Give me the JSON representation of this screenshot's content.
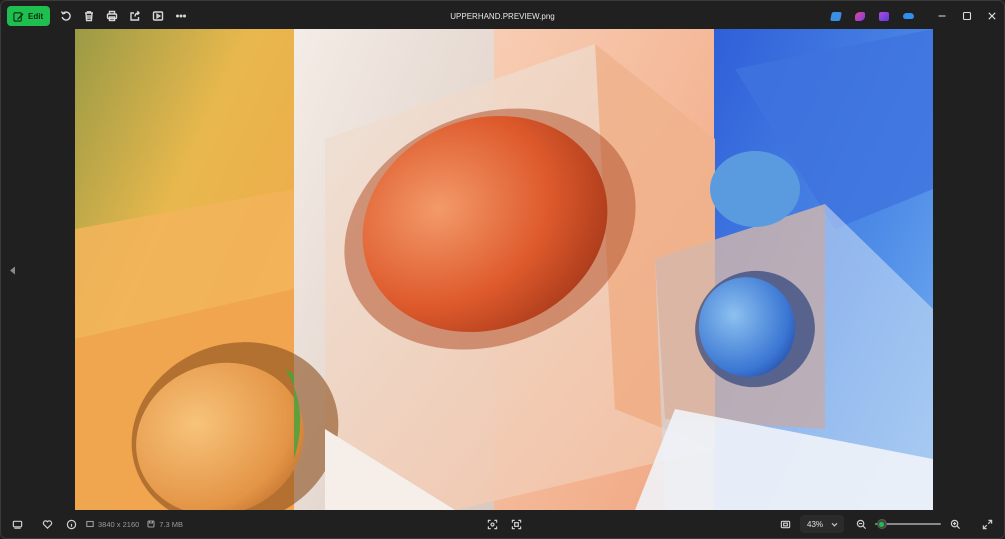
{
  "window": {
    "title": "UPPERHAND.PREVIEW.png"
  },
  "toolbar": {
    "edit_label": "Edit",
    "tools": [
      "rotate-icon",
      "delete-icon",
      "print-icon",
      "share-icon",
      "slideshow-icon",
      "more-icon"
    ]
  },
  "apps": [
    {
      "name": "app-icon-1",
      "color": "#3a8fe0"
    },
    {
      "name": "app-icon-2",
      "color": "#c53fd6"
    },
    {
      "name": "app-icon-3",
      "color": "#8e44e8"
    },
    {
      "name": "onedrive-icon",
      "color": "#2f8ef0"
    }
  ],
  "status": {
    "dimensions": "3840 x 2160",
    "file_size": "7.3 MB",
    "zoom_label": "43%",
    "zoom_fraction": 0.1
  },
  "colors": {
    "accent": "#1fbf4f"
  }
}
